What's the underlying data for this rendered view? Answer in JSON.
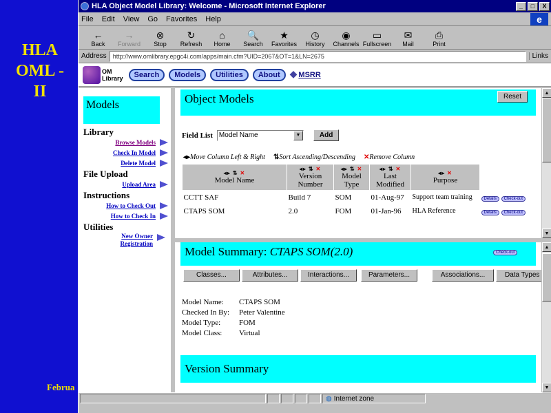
{
  "slide": {
    "title_lines": [
      "HLA",
      "OML -",
      "II"
    ],
    "footer": "Februa"
  },
  "window": {
    "title": "HLA Object Model Library: Welcome - Microsoft Internet Explorer",
    "controls": [
      "_",
      "□",
      "X"
    ]
  },
  "menu": [
    "File",
    "Edit",
    "View",
    "Go",
    "Favorites",
    "Help"
  ],
  "toolbar": [
    {
      "label": "Back",
      "icon": "←",
      "disabled": false
    },
    {
      "label": "Forward",
      "icon": "→",
      "disabled": true
    },
    {
      "label": "Stop",
      "icon": "⊗",
      "disabled": false
    },
    {
      "label": "Refresh",
      "icon": "↻",
      "disabled": false
    },
    {
      "label": "Home",
      "icon": "⌂",
      "disabled": false
    },
    {
      "label": "Search",
      "icon": "🔍",
      "disabled": false
    },
    {
      "label": "Favorites",
      "icon": "★",
      "disabled": false
    },
    {
      "label": "History",
      "icon": "◷",
      "disabled": false
    },
    {
      "label": "Channels",
      "icon": "◉",
      "disabled": false
    },
    {
      "label": "Fullscreen",
      "icon": "▭",
      "disabled": false
    },
    {
      "label": "Mail",
      "icon": "✉",
      "disabled": false
    },
    {
      "label": "Print",
      "icon": "⎙",
      "disabled": false
    }
  ],
  "address": {
    "label": "Address",
    "url": "http://www.omlibrary.epgc4i.com/apps/main.cfm?UID=2067&OT=1&LN=2675",
    "links": "Links"
  },
  "nav": {
    "logo_text": [
      "OM",
      "Library"
    ],
    "buttons": [
      "Search",
      "Models",
      "Utilities",
      "About"
    ],
    "msrr": "MSRR"
  },
  "left": {
    "heading": "Models",
    "sections": [
      {
        "title": "Library",
        "links": [
          "Browse Models",
          "Check In Model",
          "Delete Model"
        ]
      },
      {
        "title": "File Upload",
        "links": [
          "Upload Area"
        ]
      },
      {
        "title": "Instructions",
        "links": [
          "How to Check Out",
          "How to Check In"
        ]
      },
      {
        "title": "Utilities",
        "links": [
          "New Owner Registration"
        ]
      }
    ]
  },
  "object_models": {
    "heading": "Object Models",
    "reset_label": "Reset",
    "field_list_label": "Field List",
    "field_select_value": "Model Name",
    "add_label": "Add",
    "legend": [
      "Move Column Left & Right",
      "Sort Ascending/Descending",
      "Remove Column"
    ],
    "columns": [
      "Model Name",
      "Version Number",
      "Model Type",
      "Last Modified",
      "Purpose"
    ],
    "rows": [
      {
        "name": "CCTT SAF",
        "version": "Build 7",
        "type": "SOM",
        "modified": "01-Aug-97",
        "purpose": "Support team training"
      },
      {
        "name": "CTAPS SOM",
        "version": "2.0",
        "type": "FOM",
        "modified": "01-Jan-96",
        "purpose": "HLA Reference"
      }
    ],
    "details_label": "Details",
    "checkout_label": "Check-out"
  },
  "model_summary": {
    "heading_prefix": "Model Summary: ",
    "heading_model": "CTAPS SOM(2.0)",
    "checkout_label": "Check-out",
    "tabs": [
      "Classes...",
      "Attributes...",
      "Interactions...",
      "Parameters...",
      "Associations...",
      "Data Types"
    ],
    "fields": [
      {
        "key": "Model Name:",
        "value": "CTAPS SOM"
      },
      {
        "key": "Checked In By:",
        "value": "Peter Valentine"
      },
      {
        "key": "Model Type:",
        "value": "FOM"
      },
      {
        "key": "Model Class:",
        "value": "Virtual"
      }
    ],
    "version_heading": "Version Summary"
  },
  "status": {
    "zone": "Internet zone"
  }
}
